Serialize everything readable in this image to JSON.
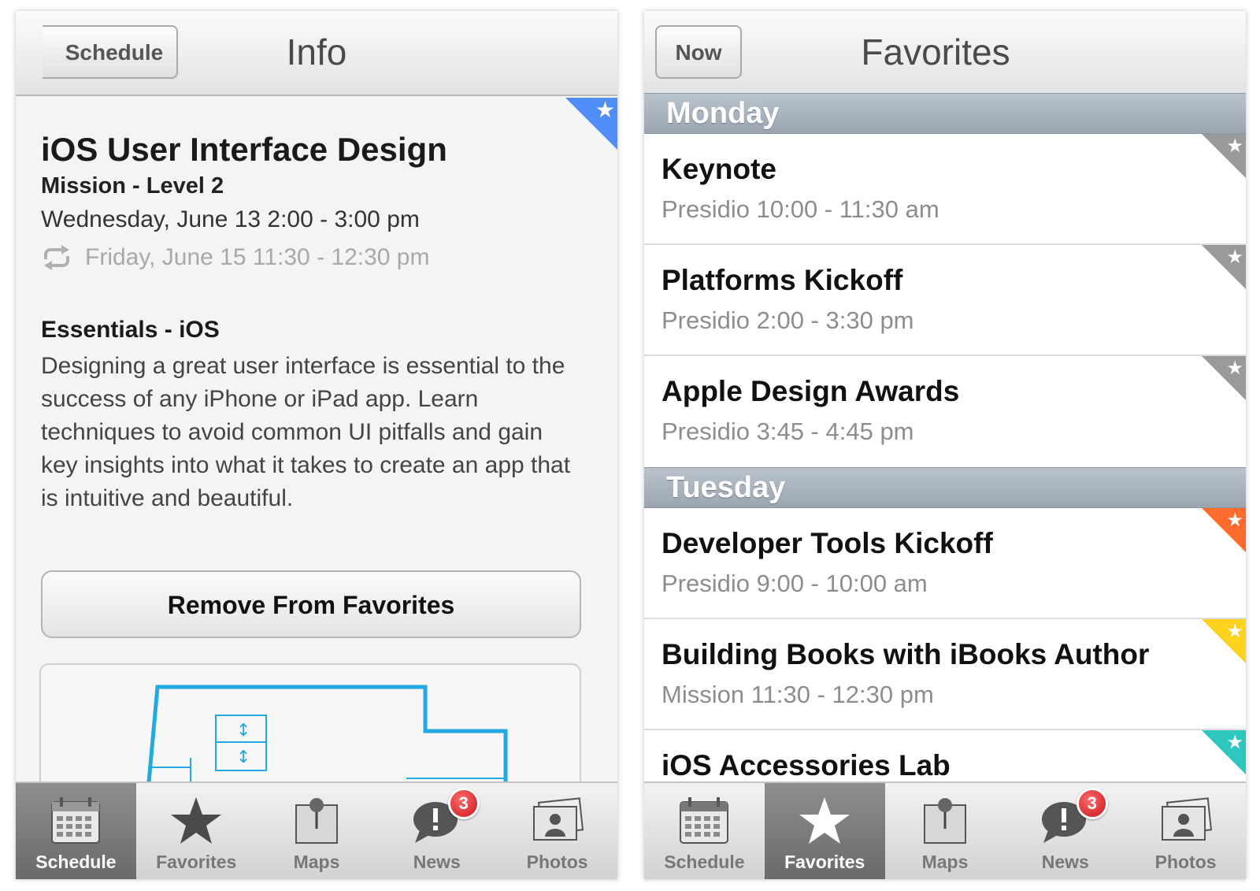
{
  "colors": {
    "flag_blue": "#4f8ef7",
    "flag_gray": "#9a9a9a",
    "flag_orange": "#ff6b2c",
    "flag_yellow": "#ffd21f",
    "flag_teal": "#2ec7c0",
    "day_header": "#a9b3bd",
    "map_blue": "#22a9e0"
  },
  "left": {
    "back_label": "Schedule",
    "title": "Info",
    "session": {
      "title": "iOS User Interface Design",
      "room": "Mission - Level 2",
      "time": "Wednesday, June 13 2:00 - 3:00 pm",
      "repeat_time": "Friday, June 15 11:30 - 12:30 pm",
      "repeat_icon": "repeat-icon",
      "track": "Essentials - iOS",
      "description": "Designing a great user interface is essential to the success of any iPhone or iPad app. Learn techniques to avoid common UI pitfalls and gain key insights into what it takes to create an app that is intuitive and beautiful.",
      "flag_icon": "star-icon"
    },
    "remove_label": "Remove From Favorites",
    "map_icon": "floor-map"
  },
  "right": {
    "now_label": "Now",
    "title": "Favorites",
    "days": [
      {
        "name": "Monday",
        "items": [
          {
            "title": "Keynote",
            "subtitle": "Presidio 10:00 - 11:30 am",
            "flag": "#9a9a9a"
          },
          {
            "title": "Platforms Kickoff",
            "subtitle": "Presidio 2:00 - 3:30 pm",
            "flag": "#9a9a9a"
          },
          {
            "title": "Apple Design Awards",
            "subtitle": "Presidio 3:45 - 4:45 pm",
            "flag": "#9a9a9a"
          }
        ]
      },
      {
        "name": "Tuesday",
        "items": [
          {
            "title": "Developer Tools Kickoff",
            "subtitle": "Presidio 9:00 - 10:00 am",
            "flag": "#ff6b2c"
          },
          {
            "title": "Building Books with iBooks Author",
            "subtitle": "Mission 11:30 - 12:30 pm",
            "flag": "#ffd21f"
          },
          {
            "title": "iOS Accessories Lab",
            "subtitle": "",
            "flag": "#2ec7c0"
          }
        ]
      }
    ]
  },
  "tabs": [
    {
      "label": "Schedule",
      "icon": "calendar-icon"
    },
    {
      "label": "Favorites",
      "icon": "star-icon"
    },
    {
      "label": "Maps",
      "icon": "map-pin-icon"
    },
    {
      "label": "News",
      "icon": "speech-bubble-icon",
      "badge": "3"
    },
    {
      "label": "Photos",
      "icon": "photos-icon"
    }
  ]
}
